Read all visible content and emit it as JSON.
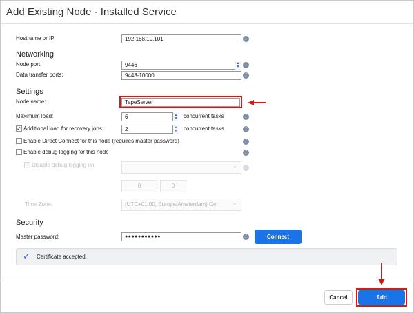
{
  "dialog": {
    "title": "Add Existing Node - Installed Service"
  },
  "hostname": {
    "label": "Hostname or IP:",
    "value": "192.168.10.101"
  },
  "networking": {
    "heading": "Networking",
    "node_port": {
      "label": "Node port:",
      "value": "9446"
    },
    "transfer_ports": {
      "label": "Data transfer ports:",
      "value": "9448-10000"
    }
  },
  "settings": {
    "heading": "Settings",
    "node_name": {
      "label": "Node name:",
      "value": "TapeServer"
    },
    "max_load": {
      "label": "Maximum load:",
      "value": "6",
      "unit": "concurrent tasks"
    },
    "recovery_load": {
      "label": "Additional load for recovery jobs:",
      "value": "2",
      "unit": "concurrent tasks",
      "checked": true
    },
    "direct_connect": {
      "label": "Enable Direct Connect for this node (requires master password)",
      "checked": false
    },
    "debug_logging": {
      "label": "Enable debug logging for this node",
      "checked": false
    },
    "disable_debug_on": {
      "label": "Disable debug logging on",
      "selected": ""
    },
    "time_hours": "0",
    "time_separator": ":",
    "time_minutes": "0",
    "time_zone": {
      "label": "Time Zone:",
      "selected": "(UTC+01:00, Europe/Amsterdam) Ce"
    }
  },
  "security": {
    "heading": "Security",
    "master_password": {
      "label": "Master password:",
      "value": "●●●●●●●●●●●"
    },
    "connect_label": "Connect"
  },
  "certificate": {
    "status_text": "Certificate accepted."
  },
  "footer": {
    "cancel_label": "Cancel",
    "add_label": "Add"
  },
  "icons": {
    "info": "i",
    "check": "✓",
    "spin_up": "▲",
    "spin_down": "▼",
    "caret": "⌄"
  },
  "colors": {
    "accent": "#1a73e8",
    "highlight": "#d21a1a"
  }
}
